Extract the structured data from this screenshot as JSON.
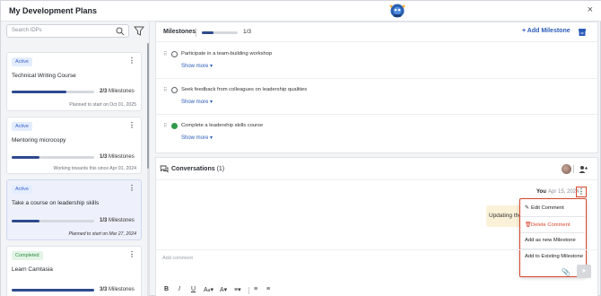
{
  "header": {
    "title": "My Development Plans",
    "close_label": "×"
  },
  "sidebar": {
    "search_placeholder": "Search IDPs",
    "plans": [
      {
        "status": "Active",
        "title": "Technical Writing Course",
        "progress": 0.667,
        "count": "2/3",
        "milestones_label": "Milestones",
        "footer": "Planned to start on Oct 01, 2025",
        "selected": false
      },
      {
        "status": "Active",
        "title": "Mentoring microcopy",
        "progress": 0.333,
        "count": "1/3",
        "milestones_label": "Milestones",
        "footer": "Working towards this since Apr 01, 2024",
        "selected": false
      },
      {
        "status": "Active",
        "title": "Take a course on leadership skills",
        "progress": 0.333,
        "count": "1/3",
        "milestones_label": "Milestones",
        "footer": "Planned to start on Mar 27, 2024",
        "selected": true
      },
      {
        "status": "Completed",
        "title": "Learn Camtasia",
        "progress": 1.0,
        "count": "3/3",
        "milestones_label": "Milestones",
        "footer": "",
        "selected": false
      }
    ]
  },
  "milestones": {
    "label": "Milestones",
    "progress": 0.333,
    "count": "1/3",
    "add_label": "+ Add Milestone",
    "items": [
      {
        "text": "Participate in a team-building workshop",
        "done": false,
        "more": "Show more"
      },
      {
        "text": "Seek feedback from colleagues on leadership qualities",
        "done": false,
        "more": "Show more"
      },
      {
        "text": "Complete a leadership skills course",
        "done": true,
        "more": "Show more"
      }
    ]
  },
  "conversations": {
    "label": "Conversations",
    "count": "(1)",
    "comment": {
      "author": "You",
      "date": "Apr 15, 2024",
      "text": "Updating the"
    },
    "menu": [
      "Edit Comment",
      "Delete Comment",
      "Add as new Milestone",
      "Add to Existing Milestone"
    ],
    "editor_placeholder": "Add comment",
    "toolbar": [
      "B",
      "I",
      "U",
      "A",
      "A",
      "≡",
      "≡",
      "≡"
    ]
  },
  "colors": {
    "accent": "#2b5bb8",
    "progress": "#2e4a8f",
    "highlight": "#d9472b",
    "success": "#2f9a4c"
  }
}
